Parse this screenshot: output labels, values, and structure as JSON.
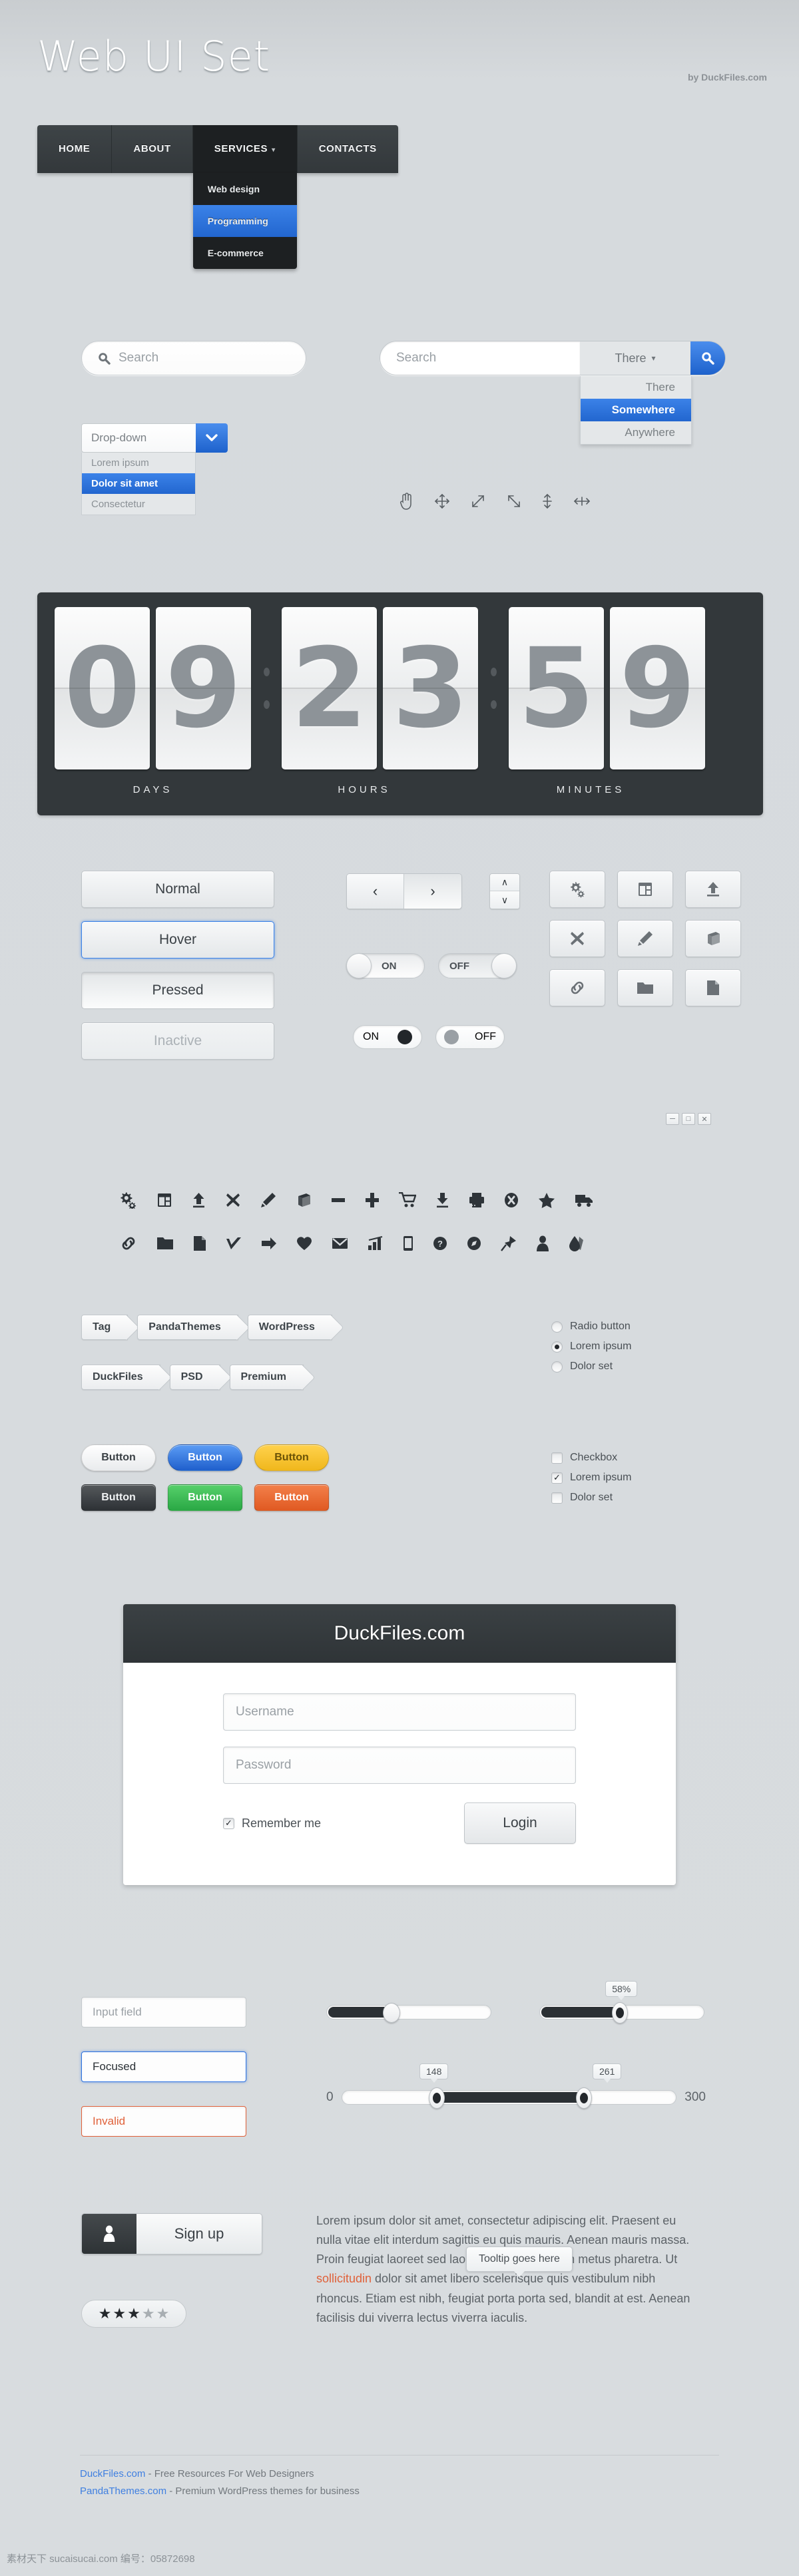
{
  "header": {
    "logo": "Web UI Set",
    "byline": "by DuckFiles.com"
  },
  "nav": {
    "items": [
      {
        "label": "HOME"
      },
      {
        "label": "ABOUT"
      },
      {
        "label": "SERVICES",
        "caret": "▾"
      },
      {
        "label": "CONTACTS"
      }
    ],
    "submenu": [
      {
        "label": "Web design",
        "selected": false
      },
      {
        "label": "Programming",
        "selected": true
      },
      {
        "label": "E-commerce",
        "selected": false
      }
    ]
  },
  "search": {
    "simple_placeholder": "Search",
    "simple_icon": "search-icon",
    "combo_placeholder": "Search",
    "combo_scope_value": "There",
    "combo_scope_caret": "▾",
    "combo_button_icon": "search-icon",
    "scope_options": [
      {
        "label": "There",
        "selected": false
      },
      {
        "label": "Somewhere",
        "selected": true
      },
      {
        "label": "Anywhere",
        "selected": false
      }
    ]
  },
  "dropdown": {
    "value": "Drop-down",
    "caret": "⌄",
    "options": [
      {
        "label": "Lorem ipsum",
        "selected": false
      },
      {
        "label": "Dolor sit amet",
        "selected": true
      },
      {
        "label": "Consectetur",
        "selected": false
      }
    ]
  },
  "cursors": [
    "pointer-hand-icon",
    "move-icon",
    "resize-ne-icon",
    "resize-nw-icon",
    "resize-vertical-icon",
    "resize-horizontal-icon"
  ],
  "countdown": {
    "days": [
      "0",
      "9"
    ],
    "hours": [
      "2",
      "3"
    ],
    "minutes": [
      "5",
      "9"
    ],
    "labels": [
      "DAYS",
      "HOURS",
      "MINUTES"
    ]
  },
  "button_states": [
    {
      "label": "Normal",
      "state": "normal"
    },
    {
      "label": "Hover",
      "state": "hover"
    },
    {
      "label": "Pressed",
      "state": "pressed"
    },
    {
      "label": "Inactive",
      "state": "inactive"
    }
  ],
  "pager": {
    "prev": "‹",
    "next": "›"
  },
  "spinner": {
    "up": "∧",
    "down": "∨"
  },
  "toggles": {
    "row1": [
      {
        "label": "ON",
        "on": true
      },
      {
        "label": "OFF",
        "on": false
      }
    ],
    "row2": [
      {
        "label": "ON",
        "on": true
      },
      {
        "label": "OFF",
        "on": false
      }
    ]
  },
  "icon_buttons": [
    "gears-icon",
    "window-layout-icon",
    "upload-icon",
    "close-x-icon",
    "pencil-icon",
    "box-icon",
    "link-icon",
    "folder-icon",
    "file-icon"
  ],
  "window_buttons": [
    "minimize-icon",
    "maximize-icon",
    "close-icon"
  ],
  "icon_rows": [
    [
      "gears-icon",
      "window-layout-icon",
      "upload-icon",
      "close-x-icon",
      "pencil-icon",
      "box-icon",
      "minus-icon",
      "plus-icon",
      "cart-icon",
      "download-icon",
      "printer-icon",
      "cancel-circle-icon",
      "star-icon",
      "truck-icon"
    ],
    [
      "link-icon",
      "folder-icon",
      "file-icon",
      "check-icon",
      "arrow-right-icon",
      "heart-icon",
      "mail-icon",
      "chart-icon",
      "mobile-icon",
      "help-icon",
      "compass-icon",
      "pin-icon",
      "user-icon",
      "tag-drop-icon"
    ]
  ],
  "tags": {
    "row1": [
      "Tag",
      "PandaThemes",
      "WordPress"
    ],
    "row2": [
      "DuckFiles",
      "PSD",
      "Premium"
    ]
  },
  "color_buttons": {
    "row1": [
      {
        "label": "Button",
        "bg_top": "#ffffff",
        "bg_bottom": "#e9ebed",
        "color": "#3a4045"
      },
      {
        "label": "Button",
        "bg_top": "#5b9cf5",
        "bg_bottom": "#1f5fcc",
        "color": "#ffffff"
      },
      {
        "label": "Button",
        "bg_top": "#ffd24d",
        "bg_bottom": "#f0b71c",
        "color": "#6b5307"
      }
    ],
    "row2": [
      {
        "label": "Button",
        "bg_top": "#55595c",
        "bg_bottom": "#2d3135",
        "color": "#f0f2f3"
      },
      {
        "label": "Button",
        "bg_top": "#56d06a",
        "bg_bottom": "#2aa845",
        "color": "#ffffff"
      },
      {
        "label": "Button",
        "bg_top": "#f3804a",
        "bg_bottom": "#e05a22",
        "color": "#ffffff"
      }
    ]
  },
  "radios": [
    {
      "label": "Radio button",
      "checked": false
    },
    {
      "label": "Lorem ipsum",
      "checked": true
    },
    {
      "label": "Dolor set",
      "checked": false
    }
  ],
  "checkboxes": [
    {
      "label": "Checkbox",
      "checked": false
    },
    {
      "label": "Lorem ipsum",
      "checked": true
    },
    {
      "label": "Dolor set",
      "checked": false
    }
  ],
  "login": {
    "title": "DuckFiles.com",
    "username_placeholder": "Username",
    "password_placeholder": "Password",
    "remember_label": "Remember me",
    "remember_checked": true,
    "submit_label": "Login"
  },
  "inputs": [
    {
      "label": "Input field",
      "state": "normal"
    },
    {
      "label": "Focused",
      "state": "focused"
    },
    {
      "label": "Invalid",
      "state": "invalid"
    }
  ],
  "sliders": {
    "plain": {
      "value_pct": 40
    },
    "bubble": {
      "label": "58%",
      "value_pct": 58
    },
    "range": {
      "min_label": "0",
      "max_label": "300",
      "low_label": "148",
      "high_label": "261",
      "low_pct": 28,
      "high_pct": 72
    }
  },
  "signup": {
    "label": "Sign up",
    "icon": "user-icon"
  },
  "rating": {
    "filled": 3,
    "total": 5,
    "star": "★"
  },
  "tooltip": {
    "text": "Tooltip goes here"
  },
  "body_text": {
    "part1": "Lorem ipsum dolor sit amet, consectetur adipiscing elit. Praesent eu nulla vitae elit interdum sagittis eu quis mauris. Aenean mauris massa. Proin feugiat laoreet sed laoreet at condimentum metus pharetra. Ut ",
    "link": "sollicitudin",
    "part2": " dolor sit amet libero scelerisque quis vestibulum nibh rhoncus. Etiam est nibh, feugiat porta porta sed, blandit at est. Aenean facilisis dui viverra lectus viverra iaculis."
  },
  "footer": {
    "line1_link": "DuckFiles.com",
    "line1_text": " - Free Resources For Web Designers",
    "line2_link": "PandaThemes.com",
    "line2_text": " - Premium WordPress themes for business",
    "watermark": "素材天下 sucaisucai.com  编号：05872698"
  },
  "colors": {
    "accent_blue": "#2266cf",
    "dark": "#33383b",
    "danger": "#e0613a"
  }
}
